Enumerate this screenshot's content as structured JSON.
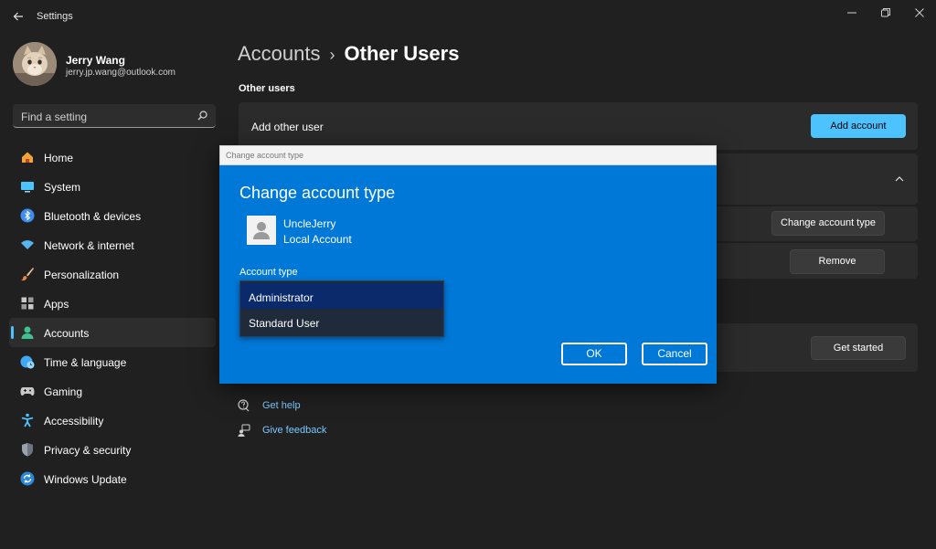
{
  "window": {
    "title": "Settings"
  },
  "profile": {
    "name": "Jerry Wang",
    "email": "jerry.jp.wang@outlook.com"
  },
  "search": {
    "placeholder": "Find a setting"
  },
  "sidebar": {
    "items": [
      {
        "label": "Home",
        "icon": "home-icon",
        "color": "#e8a23a"
      },
      {
        "label": "System",
        "icon": "system-icon",
        "color": "#4cc2ff"
      },
      {
        "label": "Bluetooth & devices",
        "icon": "bluetooth-icon",
        "color": "#3b8df5"
      },
      {
        "label": "Network & internet",
        "icon": "wifi-icon",
        "color": "#58b4f0"
      },
      {
        "label": "Personalization",
        "icon": "brush-icon",
        "color": "#e89b5a"
      },
      {
        "label": "Apps",
        "icon": "apps-icon",
        "color": "#c8c8c8"
      },
      {
        "label": "Accounts",
        "icon": "person-icon",
        "color": "#3ec28f"
      },
      {
        "label": "Time & language",
        "icon": "globe-clock-icon",
        "color": "#3fa9f5"
      },
      {
        "label": "Gaming",
        "icon": "controller-icon",
        "color": "#c8c8c8"
      },
      {
        "label": "Accessibility",
        "icon": "accessibility-icon",
        "color": "#4cc2ff"
      },
      {
        "label": "Privacy & security",
        "icon": "shield-icon",
        "color": "#9aa3ad"
      },
      {
        "label": "Windows Update",
        "icon": "update-icon",
        "color": "#2b88d8"
      }
    ],
    "active_index": 6
  },
  "main": {
    "breadcrumb_parent": "Accounts",
    "breadcrumb_sep": "›",
    "breadcrumb_current": "Other Users",
    "section_title": "Other users",
    "add_other_user_label": "Add other user",
    "add_account_button": "Add account",
    "change_account_type_button": "Change account type",
    "remove_button": "Remove",
    "get_started_button": "Get started",
    "get_help": "Get help",
    "give_feedback": "Give feedback"
  },
  "dialog": {
    "title": "Change account type",
    "heading": "Change account type",
    "user_name": "UncleJerry",
    "user_type": "Local Account",
    "field_label": "Account type",
    "options": [
      "Administrator",
      "Standard User"
    ],
    "selected_option": "Administrator",
    "ok_button": "OK",
    "cancel_button": "Cancel"
  },
  "colors": {
    "background": "#202020",
    "card": "#2b2b2b",
    "accent": "#4cc2ff",
    "dialog_blue": "#0078d7"
  }
}
